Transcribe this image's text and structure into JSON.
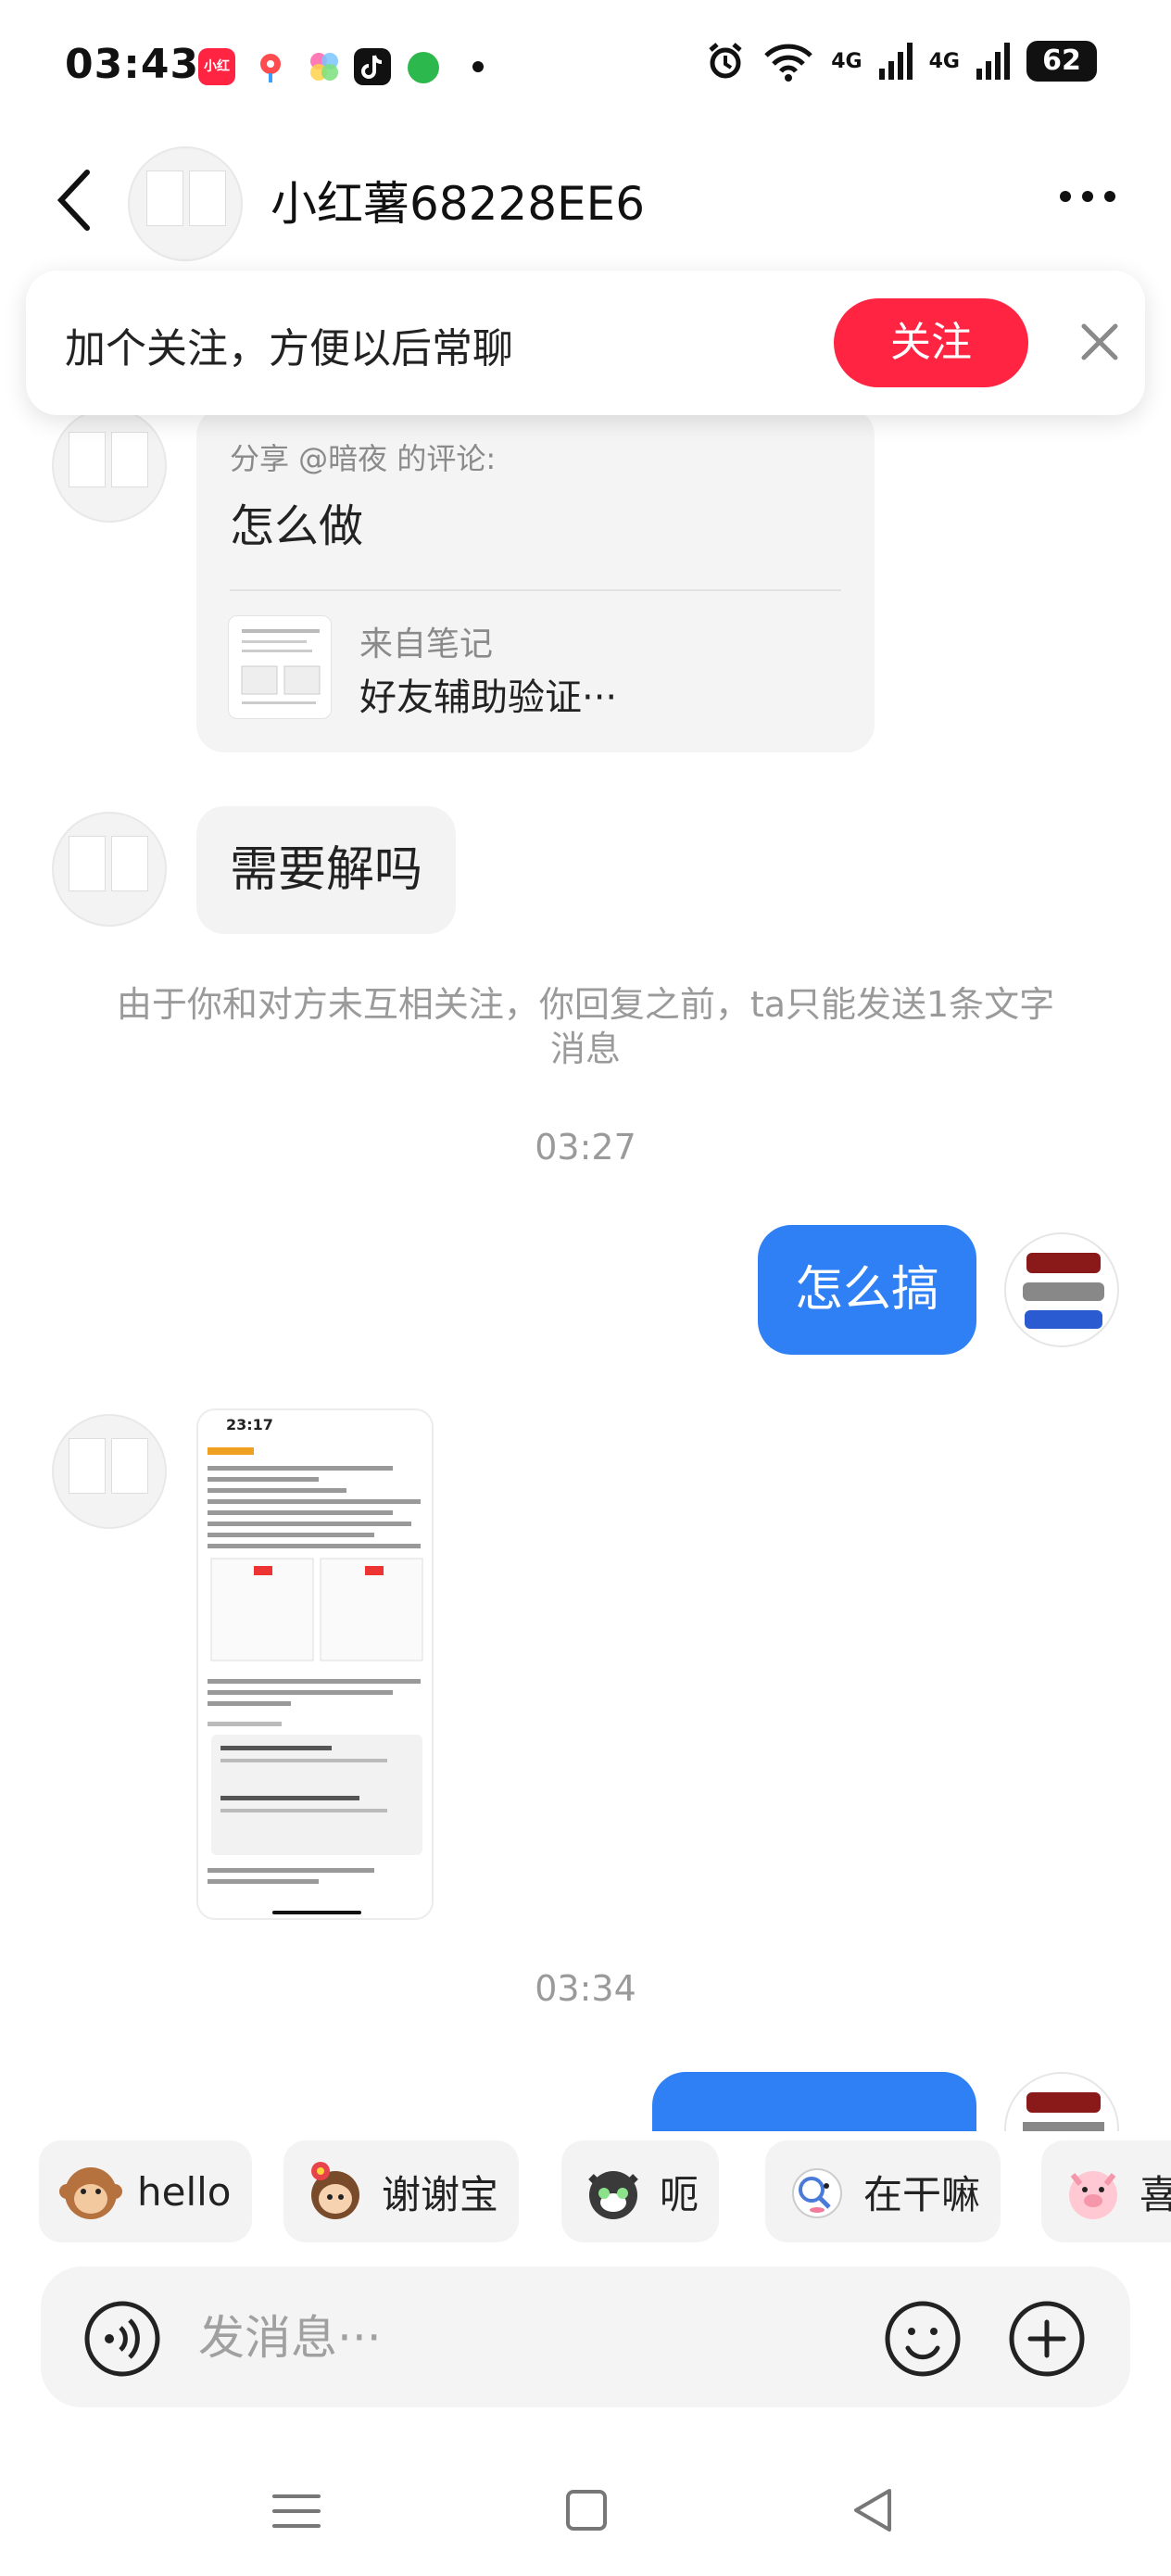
{
  "status_bar": {
    "time": "03:43",
    "xhs_icon_text": "小红书",
    "network_1": "4G",
    "network_2": "4G",
    "battery": "62"
  },
  "header": {
    "title": "小红薯68228EE6"
  },
  "follow_banner": {
    "text": "加个关注，方便以后常聊",
    "button": "关注"
  },
  "messages": {
    "share_card": {
      "from": "分享 @暗夜 的评论:",
      "content": "怎么做",
      "source_label": "来自笔记",
      "note_title": "好友辅助验证···"
    },
    "incoming_text": "需要解吗",
    "notice": "由于你和对方未互相关注，你回复之前，ta只能发送1条文字消息",
    "timestamp_1": "03:27",
    "outgoing_text": "怎么搞",
    "image_status_time": "23:17",
    "timestamp_2": "03:34"
  },
  "quick_replies": [
    {
      "label": "hello",
      "icon": "monkey-emoji-icon"
    },
    {
      "label": "谢谢宝",
      "icon": "flower-girl-emoji-icon"
    },
    {
      "label": "呃",
      "icon": "cat-emoji-icon"
    },
    {
      "label": "在干嘛",
      "icon": "magnifier-emoji-icon"
    },
    {
      "label": "喜",
      "icon": "pig-emoji-icon"
    }
  ],
  "input": {
    "placeholder": "发消息···"
  },
  "colors": {
    "brand_red": "#ff2442",
    "bubble_blue": "#2f80f5",
    "muted_text": "#9a9a9a"
  }
}
